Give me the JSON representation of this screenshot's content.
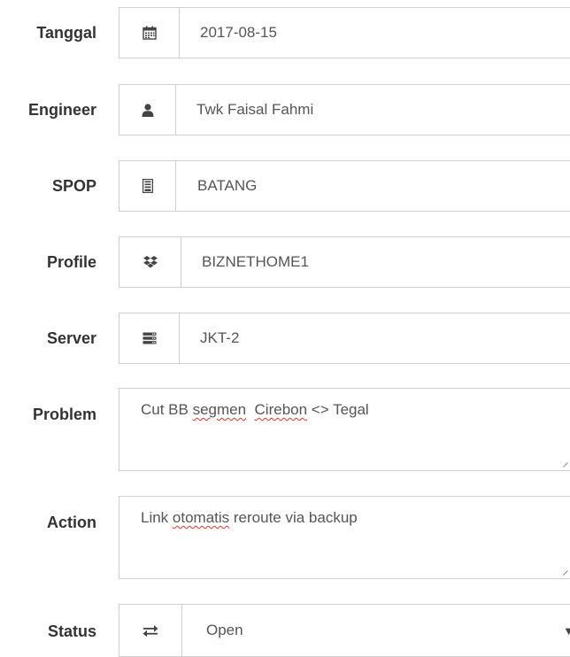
{
  "form": {
    "tanggal": {
      "label": "Tanggal",
      "value": "2017-08-15",
      "icon": "calendar-icon"
    },
    "engineer": {
      "label": "Engineer",
      "value": "Twk Faisal Fahmi",
      "icon": "user-icon"
    },
    "spop": {
      "label": "SPOP",
      "value": "BATANG",
      "icon": "building-icon"
    },
    "profile": {
      "label": "Profile",
      "value": "BIZNETHOME1",
      "icon": "dropbox-icon"
    },
    "server": {
      "label": "Server",
      "value": "JKT-2",
      "icon": "server-icon"
    },
    "problem": {
      "label": "Problem",
      "value_parts": [
        "Cut BB ",
        "segmen",
        "  ",
        "Cirebon",
        " <> Tegal"
      ]
    },
    "action": {
      "label": "Action",
      "value_parts": [
        "Link ",
        "otomatis",
        " reroute via backup"
      ]
    },
    "status": {
      "label": "Status",
      "value": "Open",
      "icon": "exchange-icon",
      "caret": "▼"
    }
  },
  "colors": {
    "border": "#cfcfcf",
    "label": "#333333",
    "value": "#555555",
    "spellcheck": "#d9342b"
  }
}
